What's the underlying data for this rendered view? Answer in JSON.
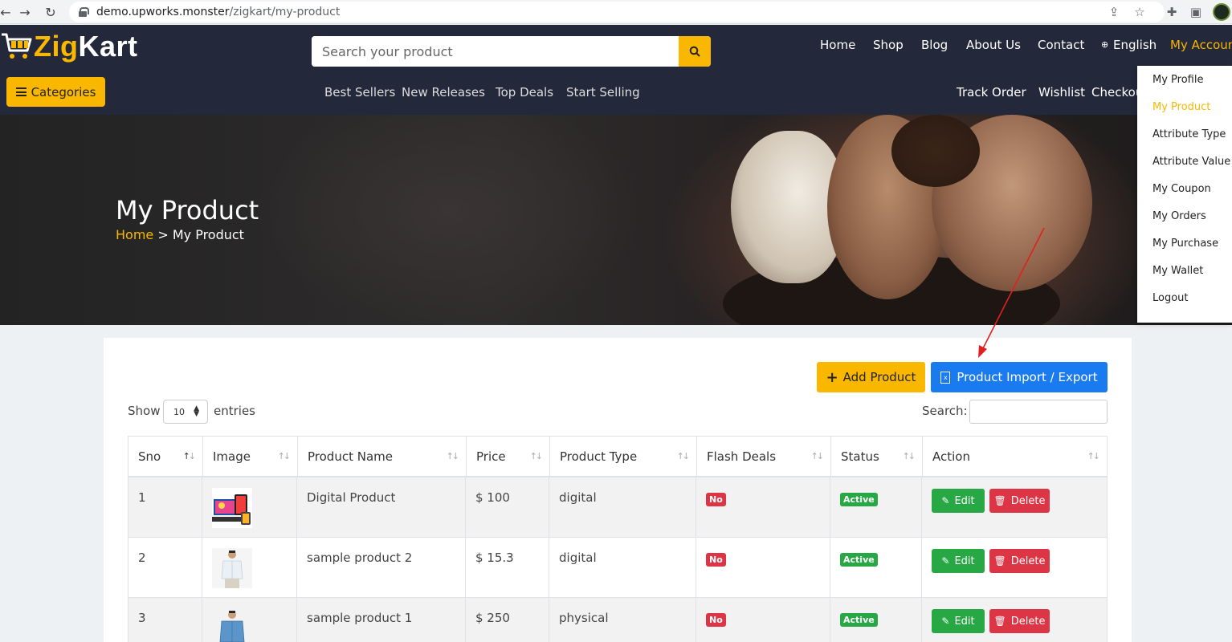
{
  "browser": {
    "url_host": "demo.upworks.monster",
    "url_path": "/zigkart/my-product"
  },
  "brand": {
    "name_prefix": "Zig",
    "name_suffix": "Kart",
    "accent_color": "#f9b700",
    "header_bg": "#23293a"
  },
  "search": {
    "placeholder": "Search your product"
  },
  "topnav": [
    {
      "label": "Home"
    },
    {
      "label": "Shop"
    },
    {
      "label": "Blog"
    },
    {
      "label": "About Us"
    },
    {
      "label": "Contact"
    },
    {
      "label": "English"
    },
    {
      "label": "My Accoun"
    }
  ],
  "categories_label": "Categories",
  "subnav": [
    {
      "label": "Best Sellers"
    },
    {
      "label": "New Releases"
    },
    {
      "label": "Top Deals"
    },
    {
      "label": "Start Selling"
    },
    {
      "label": "Track Order"
    },
    {
      "label": "Wishlist"
    },
    {
      "label": "Checkou"
    }
  ],
  "hero": {
    "title": "My Product",
    "breadcrumb_home": "Home",
    "breadcrumb_sep": ">",
    "breadcrumb_current": "My Product"
  },
  "account_menu": [
    {
      "label": "My Profile"
    },
    {
      "label": "My Product",
      "active": true
    },
    {
      "label": "Attribute Type"
    },
    {
      "label": "Attribute Value"
    },
    {
      "label": "My Coupon"
    },
    {
      "label": "My Orders"
    },
    {
      "label": "My Purchase"
    },
    {
      "label": "My Wallet"
    },
    {
      "label": "Logout"
    }
  ],
  "actions": {
    "add_product": "Add Product",
    "import_export": "Product Import / Export"
  },
  "table_controls": {
    "show": "Show",
    "page_length": "10",
    "entries": "entries",
    "search": "Search:"
  },
  "table": {
    "columns": [
      "Sno",
      "Image",
      "Product Name",
      "Price",
      "Product Type",
      "Flash Deals",
      "Status",
      "Action"
    ],
    "rows": [
      {
        "sno": "1",
        "name": "Digital Product",
        "price": "$ 100",
        "type": "digital",
        "flash": "No",
        "status": "Active",
        "image": "digital-devices-thumbnail"
      },
      {
        "sno": "2",
        "name": "sample product 2",
        "price": "$ 15.3",
        "type": "digital",
        "flash": "No",
        "status": "Active",
        "image": "white-shirt-thumbnail"
      },
      {
        "sno": "3",
        "name": "sample product 1",
        "price": "$ 250",
        "type": "physical",
        "flash": "No",
        "status": "Active",
        "image": "blue-shirt-thumbnail"
      }
    ],
    "edit_label": "Edit",
    "delete_label": "Delete"
  },
  "colors": {
    "primary_blue": "#1a7af0",
    "success": "#28a745",
    "danger": "#dc3545",
    "annotation_arrow": "#e02020"
  }
}
